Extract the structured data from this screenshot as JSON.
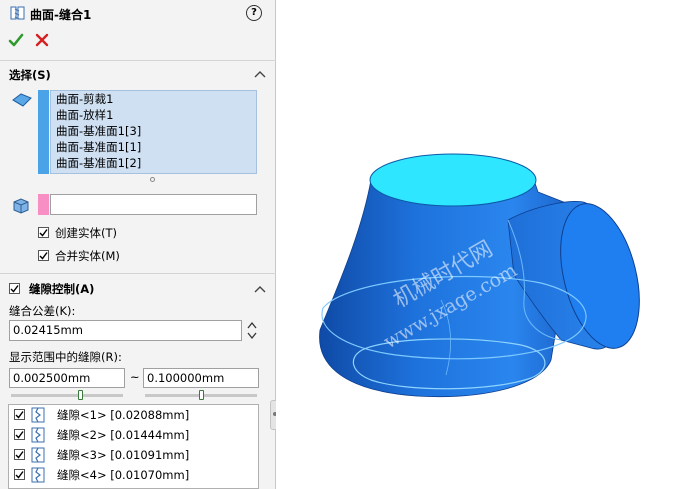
{
  "panel": {
    "title": "曲面-缝合1",
    "help_label": "?",
    "ok_icon": "check-icon",
    "cancel_icon": "close-icon",
    "selection": {
      "header": "选择(S)",
      "items": [
        "曲面-剪裁1",
        "曲面-放样1",
        "曲面-基准面1[3]",
        "曲面-基准面1[1]",
        "曲面-基准面1[2]"
      ],
      "entity_value": "",
      "create_solid_label": "创建实体(T)",
      "create_solid_checked": true,
      "merge_solid_label": "合并实体(M)",
      "merge_solid_checked": true
    },
    "gap_control": {
      "header": "缝隙控制(A)",
      "checked": true,
      "tolerance_label": "缝合公差(K):",
      "tolerance_value": "0.02415mm",
      "range_label": "显示范围中的缝隙(R):",
      "range_min": "0.002500mm",
      "range_separator": "~",
      "range_max": "0.100000mm",
      "gaps": [
        {
          "label": "缝隙<1> [0.02088mm]",
          "checked": true
        },
        {
          "label": "缝隙<2> [0.01444mm]",
          "checked": true
        },
        {
          "label": "缝隙<3> [0.01091mm]",
          "checked": true
        },
        {
          "label": "缝隙<4> [0.01070mm]",
          "checked": true
        }
      ]
    }
  },
  "viewport": {
    "watermark_line1": "机械时代网",
    "watermark_line2": "www.jxage.com"
  },
  "colors": {
    "check": "#2e9a2e",
    "cross": "#d42020",
    "surface_dark": "#1154b8",
    "surface_mid": "#1e72dc",
    "surface_light": "#2f8cf0",
    "cap": "#2ee6ff",
    "selection_bg": "#cfe0f3"
  }
}
